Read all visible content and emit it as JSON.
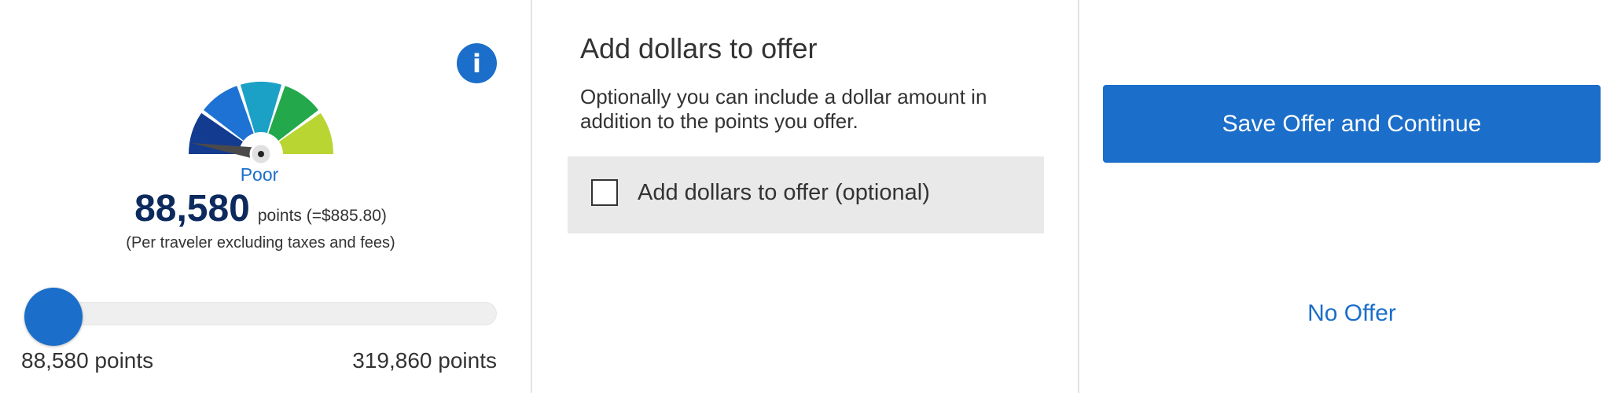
{
  "offer_panel": {
    "info_icon": "info-icon",
    "gauge": {
      "rating": "Poor",
      "level": 0.05,
      "segment_colors": [
        "#133b8f",
        "#1d72d4",
        "#1ba1c6",
        "#23a84b",
        "#b9d531"
      ],
      "needle_color": "#4a4a4a"
    },
    "points_value": "88,580",
    "points_suffix": "points (=$885.80)",
    "note": "(Per traveler excluding taxes and fees)",
    "slider": {
      "min_label": "88,580 points",
      "max_label": "319,860 points",
      "position": 0.0
    }
  },
  "dollars_panel": {
    "title": "Add dollars to offer",
    "description": "Optionally you can include a dollar amount in addition to the points you offer.",
    "checkbox_label": "Add dollars to offer (optional)",
    "checkbox_checked": false
  },
  "actions": {
    "save_label": "Save Offer and Continue",
    "no_offer_label": "No Offer"
  },
  "colors": {
    "accent": "#1b6ec9",
    "points_text": "#0d2a5e"
  }
}
